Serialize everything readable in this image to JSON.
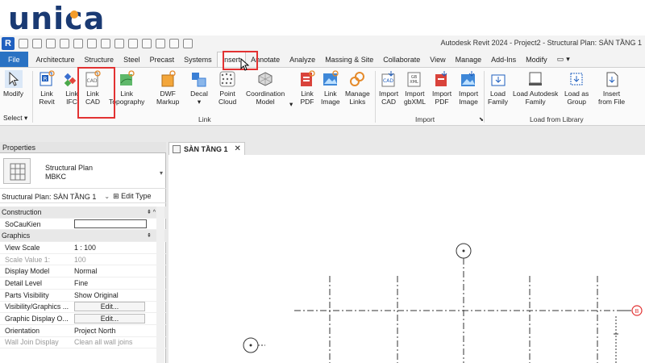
{
  "watermark": {
    "brand": "unica"
  },
  "window": {
    "title": "Autodesk Revit 2024 - Project2 - Structural Plan: SÀN TẦNG 1",
    "app_logo": "R"
  },
  "tabs": {
    "file": "File",
    "items": [
      "Architecture",
      "Structure",
      "Steel",
      "Precast",
      "Systems",
      "Insert",
      "Annotate",
      "Analyze",
      "Massing & Site",
      "Collaborate",
      "View",
      "Manage",
      "Add-Ins",
      "Modify"
    ],
    "active": "Insert"
  },
  "ribbon": {
    "modify": {
      "label": "Modify"
    },
    "select": {
      "label": "Select"
    },
    "link_revit": {
      "label1": "Link",
      "label2": "Revit"
    },
    "link_ifc": {
      "label1": "Link",
      "label2": "IFC"
    },
    "link_cad": {
      "label1": "Link",
      "label2": "CAD"
    },
    "link_topography": {
      "label1": "Link",
      "label2": "Topography"
    },
    "dwf_markup": {
      "label1": "DWF",
      "label2": "Markup"
    },
    "decal": {
      "label1": "Decal"
    },
    "point_cloud": {
      "label1": "Point",
      "label2": "Cloud"
    },
    "coordination_model": {
      "label1": "Coordination",
      "label2": "Model"
    },
    "link_pdf": {
      "label1": "Link",
      "label2": "PDF"
    },
    "link_image": {
      "label1": "Link",
      "label2": "Image"
    },
    "manage_links": {
      "label1": "Manage",
      "label2": "Links"
    },
    "import_cad": {
      "label1": "Import",
      "label2": "CAD"
    },
    "import_gbxml": {
      "label1": "Import",
      "label2": "gbXML"
    },
    "import_pdf": {
      "label1": "Import",
      "label2": "PDF"
    },
    "import_image": {
      "label1": "Import",
      "label2": "Image"
    },
    "load_family": {
      "label1": "Load",
      "label2": "Family"
    },
    "load_autodesk_family": {
      "label1": "Load Autodesk",
      "label2": "Family"
    },
    "load_as_group": {
      "label1": "Load as",
      "label2": "Group"
    },
    "insert_from_file": {
      "label1": "Insert",
      "label2": "from File"
    },
    "panels": {
      "link": "Link",
      "import": "Import",
      "load_from_library": "Load from Library"
    }
  },
  "properties": {
    "title": "Properties",
    "type_name": "Structural Plan",
    "type_sub": "MBKC",
    "selector": "Structural Plan: SÀN TẦNG 1",
    "edit_type": "Edit Type",
    "rows": [
      {
        "kind": "header",
        "key": "Construction"
      },
      {
        "kind": "input",
        "key": "SoCauKien",
        "value": ""
      },
      {
        "kind": "header",
        "key": "Graphics"
      },
      {
        "kind": "text",
        "key": "View Scale",
        "value": "1 : 100"
      },
      {
        "kind": "dim",
        "key": "Scale Value    1:",
        "value": "100"
      },
      {
        "kind": "text",
        "key": "Display Model",
        "value": "Normal"
      },
      {
        "kind": "text",
        "key": "Detail Level",
        "value": "Fine"
      },
      {
        "kind": "text",
        "key": "Parts Visibility",
        "value": "Show Original"
      },
      {
        "kind": "button",
        "key": "Visibility/Graphics ...",
        "value": "Edit..."
      },
      {
        "kind": "button",
        "key": "Graphic Display O...",
        "value": "Edit..."
      },
      {
        "kind": "text",
        "key": "Orientation",
        "value": "Project North"
      },
      {
        "kind": "dim",
        "key": "Wall Join Display",
        "value": "Clean all wall joins"
      }
    ]
  },
  "view": {
    "tab_label": "SÀN TẦNG 1",
    "grid_bubble": "B"
  },
  "colors": {
    "file_tab": "#2a72c3",
    "highlight": "#e23232",
    "brand": "#1a3a73",
    "brand_dot": "#f39c2b"
  }
}
